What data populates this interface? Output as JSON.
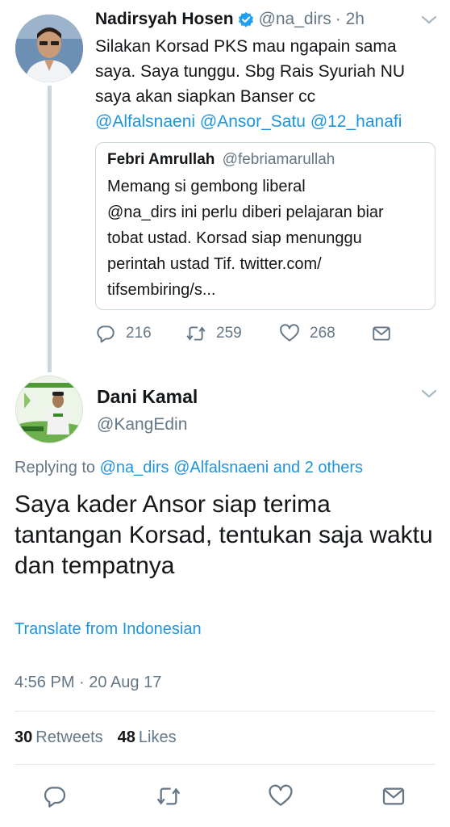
{
  "original_tweet": {
    "display_name": "Nadirsyah Hosen",
    "handle": "@na_dirs",
    "time": "· 2h",
    "text_lines": [
      "Silakan Korsad PKS mau ngapain sama",
      "saya. Saya tunggu. Sbg Rais Syuriah NU",
      "saya akan siapkan Banser cc"
    ],
    "mentions": [
      "@Alfalsnaeni",
      "@Ansor_Satu",
      "@12_hanafi"
    ],
    "quoted": {
      "display_name": "Febri Amrullah",
      "handle": "@febriamarullah",
      "text": "Memang si gembong  liberal\n@na_dirs ini perlu diberi pelajaran biar\ntobat ustad.  Korsad siap menunggu\nperintah ustad Tif. twitter.com/\ntifsembiring/s..."
    },
    "actions": {
      "replies": "216",
      "retweets": "259",
      "likes": "268"
    }
  },
  "reply_tweet": {
    "display_name": "Dani Kamal",
    "handle": "@KangEdin",
    "replying_prefix": "Replying to",
    "replying_targets": "@na_dirs @Alfalsnaeni and 2 others",
    "text": "Saya kader Ansor siap terima tantangan Korsad, tentukan saja waktu dan tempatnya",
    "translate_label": "Translate from Indonesian",
    "timestamp": "4:56 PM · 20 Aug 17",
    "retweet_count": "30",
    "retweet_label": "Retweets",
    "like_count": "48",
    "like_label": "Likes"
  },
  "icons": {
    "reply": "reply-icon",
    "retweet": "retweet-icon",
    "like": "heart-icon",
    "share": "message-icon",
    "verified": "verified-badge-icon",
    "more": "chevron-down-icon"
  },
  "colors": {
    "link": "#1b95e0",
    "secondary_text": "#657786",
    "primary_text": "#14171a",
    "border": "#ccd6dd",
    "verified": "#1da1f2"
  }
}
